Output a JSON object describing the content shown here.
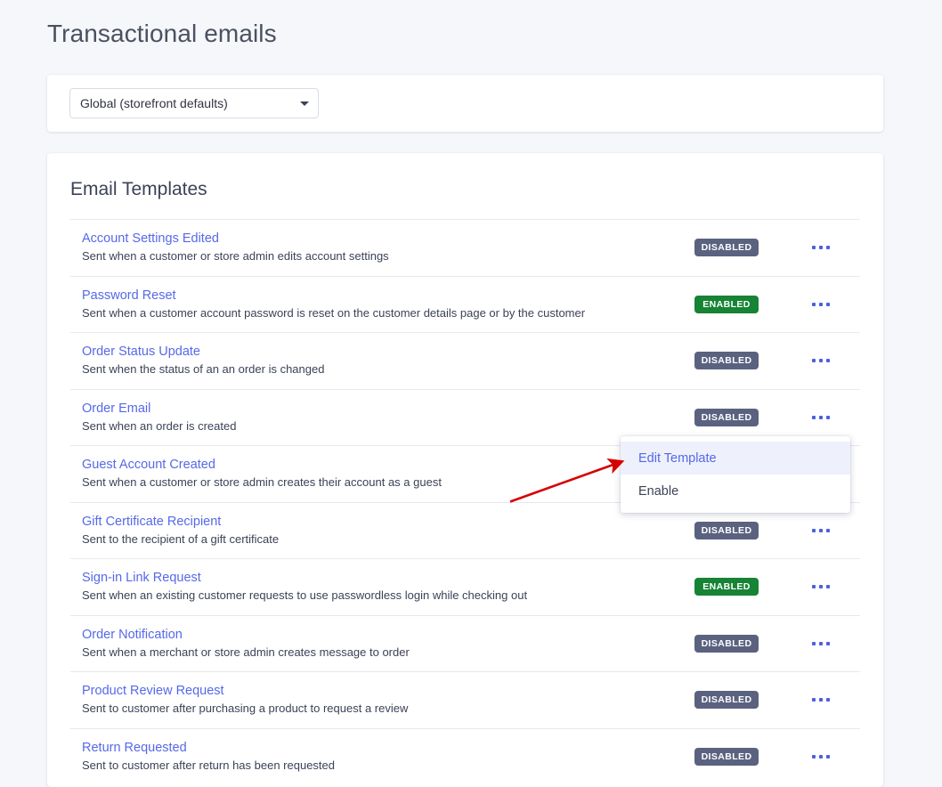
{
  "page": {
    "title": "Transactional emails"
  },
  "selector": {
    "value": "Global (storefront defaults)",
    "caret_icon": "chevron-down-icon"
  },
  "templates_card": {
    "heading": "Email Templates",
    "status_labels": {
      "enabled": "ENABLED",
      "disabled": "DISABLED"
    },
    "overflow_icon": "ellipsis-horizontal-icon",
    "rows": [
      {
        "title": "Account Settings Edited",
        "description": "Sent when a customer or store admin edits account settings",
        "status": "DISABLED"
      },
      {
        "title": "Password Reset",
        "description": "Sent when a customer account password is reset on the customer details page or by the customer",
        "status": "ENABLED"
      },
      {
        "title": "Order Status Update",
        "description": "Sent when the status of an an order is changed",
        "status": "DISABLED"
      },
      {
        "title": "Order Email",
        "description": "Sent when an order is created",
        "status": "DISABLED"
      },
      {
        "title": "Guest Account Created",
        "description": "Sent when a customer or store admin creates their account as a guest",
        "status": ""
      },
      {
        "title": "Gift Certificate Recipient",
        "description": "Sent to the recipient of a gift certificate",
        "status": "DISABLED"
      },
      {
        "title": "Sign-in Link Request",
        "description": "Sent when an existing customer requests to use passwordless login while checking out",
        "status": "ENABLED"
      },
      {
        "title": "Order Notification",
        "description": "Sent when a merchant or store admin creates message to order",
        "status": "DISABLED"
      },
      {
        "title": "Product Review Request",
        "description": "Sent to customer after purchasing a product to request a review",
        "status": "DISABLED"
      },
      {
        "title": "Return Requested",
        "description": "Sent to customer after return has been requested",
        "status": "DISABLED"
      }
    ]
  },
  "context_menu": {
    "items": [
      {
        "label": "Edit Template",
        "highlighted": true
      },
      {
        "label": "Enable",
        "highlighted": false
      }
    ]
  },
  "annotation": {
    "arrow_color": "#d60000"
  },
  "colors": {
    "background": "#f6f7fa",
    "card": "#ffffff",
    "link": "#5569e8",
    "text": "#3c4257",
    "badge_enabled": "#168335",
    "badge_disabled": "#5b6280",
    "menu_highlight": "#eef0fb"
  }
}
